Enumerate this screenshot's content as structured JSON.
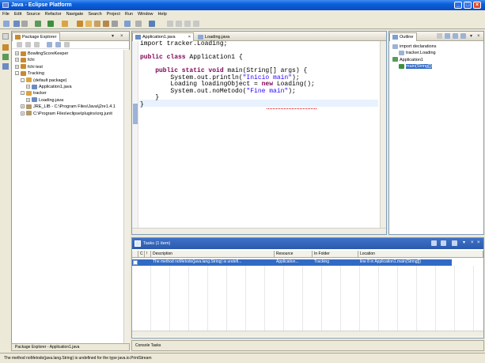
{
  "window": {
    "title": "Java - Eclipse Platform"
  },
  "menu": [
    "File",
    "Edit",
    "Source",
    "Refactor",
    "Navigate",
    "Search",
    "Project",
    "Run",
    "Window",
    "Help"
  ],
  "package_explorer": {
    "tab_label": "Package Explorer",
    "items": [
      {
        "label": "BowlingScoreKeeper",
        "level": 0,
        "expander": "+"
      },
      {
        "label": "fchi",
        "level": 0,
        "expander": "+"
      },
      {
        "label": "fchi test",
        "level": 0,
        "expander": "+"
      },
      {
        "label": "Tracking",
        "level": 0,
        "expander": "-"
      },
      {
        "label": "(default package)",
        "level": 1,
        "expander": "-"
      },
      {
        "label": "Application1.java",
        "level": 2,
        "expander": "+"
      },
      {
        "label": "tracker",
        "level": 1,
        "expander": "-"
      },
      {
        "label": "Loading.java",
        "level": 2,
        "expander": "+"
      },
      {
        "label": "JRE_LIB - C:\\Program Files\\Java\\j2re1.4.1",
        "level": 1,
        "expander": "+"
      },
      {
        "label": "C:\\Program Files\\eclipse\\plugins\\org.junit",
        "level": 1,
        "expander": "+"
      }
    ],
    "status": "Package Explorer - Application1.java"
  },
  "editor": {
    "tabs": [
      {
        "label": "Application1.java",
        "active": true
      },
      {
        "label": "Loading.java",
        "active": false
      }
    ],
    "lines": [
      {
        "parts": [
          {
            "t": "import tracker.Loading;",
            "c": ""
          }
        ]
      },
      {
        "parts": [
          {
            "t": "",
            "c": ""
          }
        ]
      },
      {
        "parts": [
          {
            "t": "public class ",
            "c": "kw"
          },
          {
            "t": "Application1 {",
            "c": ""
          }
        ]
      },
      {
        "parts": [
          {
            "t": "",
            "c": ""
          }
        ]
      },
      {
        "parts": [
          {
            "t": "    public static void ",
            "c": "kw"
          },
          {
            "t": "main(String[] args) {",
            "c": ""
          }
        ]
      },
      {
        "parts": [
          {
            "t": "        System.out.println(",
            "c": ""
          },
          {
            "t": "\"Inicio main\"",
            "c": "str"
          },
          {
            "t": ");",
            "c": ""
          }
        ]
      },
      {
        "parts": [
          {
            "t": "        Loading loadingObject = ",
            "c": ""
          },
          {
            "t": "new ",
            "c": "kw"
          },
          {
            "t": "Loading();",
            "c": ""
          }
        ]
      },
      {
        "parts": [
          {
            "t": "        System.out.noMetodo(",
            "c": ""
          },
          {
            "t": "\"Fine main\"",
            "c": "str"
          },
          {
            "t": ");",
            "c": ""
          }
        ]
      },
      {
        "parts": [
          {
            "t": "    }",
            "c": ""
          }
        ]
      },
      {
        "parts": [
          {
            "t": "}",
            "c": ""
          }
        ]
      }
    ]
  },
  "outline": {
    "tab_label": "Outline",
    "items": [
      {
        "label": "import declarations",
        "level": 0
      },
      {
        "label": "tracker.Loading",
        "level": 1
      },
      {
        "label": "Application1",
        "level": 0
      },
      {
        "label": "main(String[])",
        "level": 1
      }
    ]
  },
  "tasks": {
    "tab_label": "Tasks (1 item)",
    "columns": [
      "",
      "C",
      "!",
      "Description",
      "Resource",
      "In Folder",
      "Location"
    ],
    "rows": [
      {
        "description": "The method noMetodo(java.lang.String) is undefi...",
        "resource": "Application...",
        "folder": "Tracking",
        "location": "line 8 in Application1.main(String[])"
      }
    ]
  },
  "bottom_left_status": "Console  Tasks",
  "statusbar": {
    "message": "The method noMetodo(java.lang.String) is undefined for the type java.io.PrintStream"
  },
  "colors": {
    "titlebar": "#0A5FD8",
    "selection": "#316AC5",
    "keyword": "#7F0055",
    "string": "#2A00FF"
  }
}
